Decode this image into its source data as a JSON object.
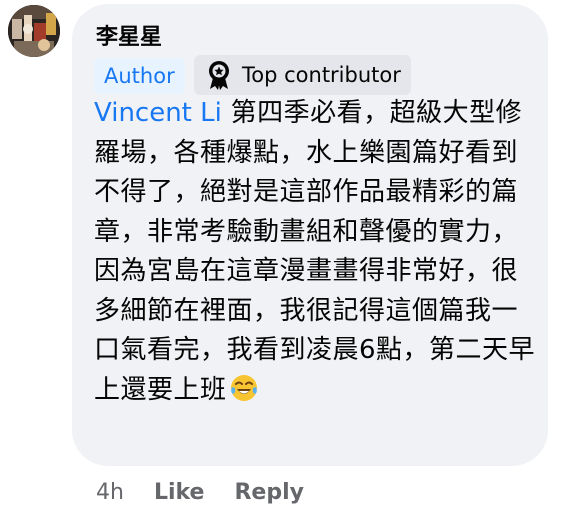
{
  "comment": {
    "author_name": "李星星",
    "badges": {
      "author": "Author",
      "top_contributor": "Top contributor",
      "top_contributor_icon": "award-badge-icon"
    },
    "mention": "Vincent Li",
    "text": " 第四季必看，超級大型修羅場，各種爆點，水上樂園篇好看到不得了，絕對是這部作品最精彩的篇章，非常考驗動畫組和聲優的實力，因為宮島在這章漫畫畫得非常好，很多細節在裡面，我很記得這個篇我一口氣看完，我看到凌晨6點，第二天早上還要上班",
    "emoji": "tears-of-joy-emoji"
  },
  "actions": {
    "time": "4h",
    "like": "Like",
    "reply": "Reply"
  },
  "colors": {
    "bubble": "#f0f2f5",
    "link_blue": "#1877f2",
    "secondary_text": "#65676b"
  }
}
